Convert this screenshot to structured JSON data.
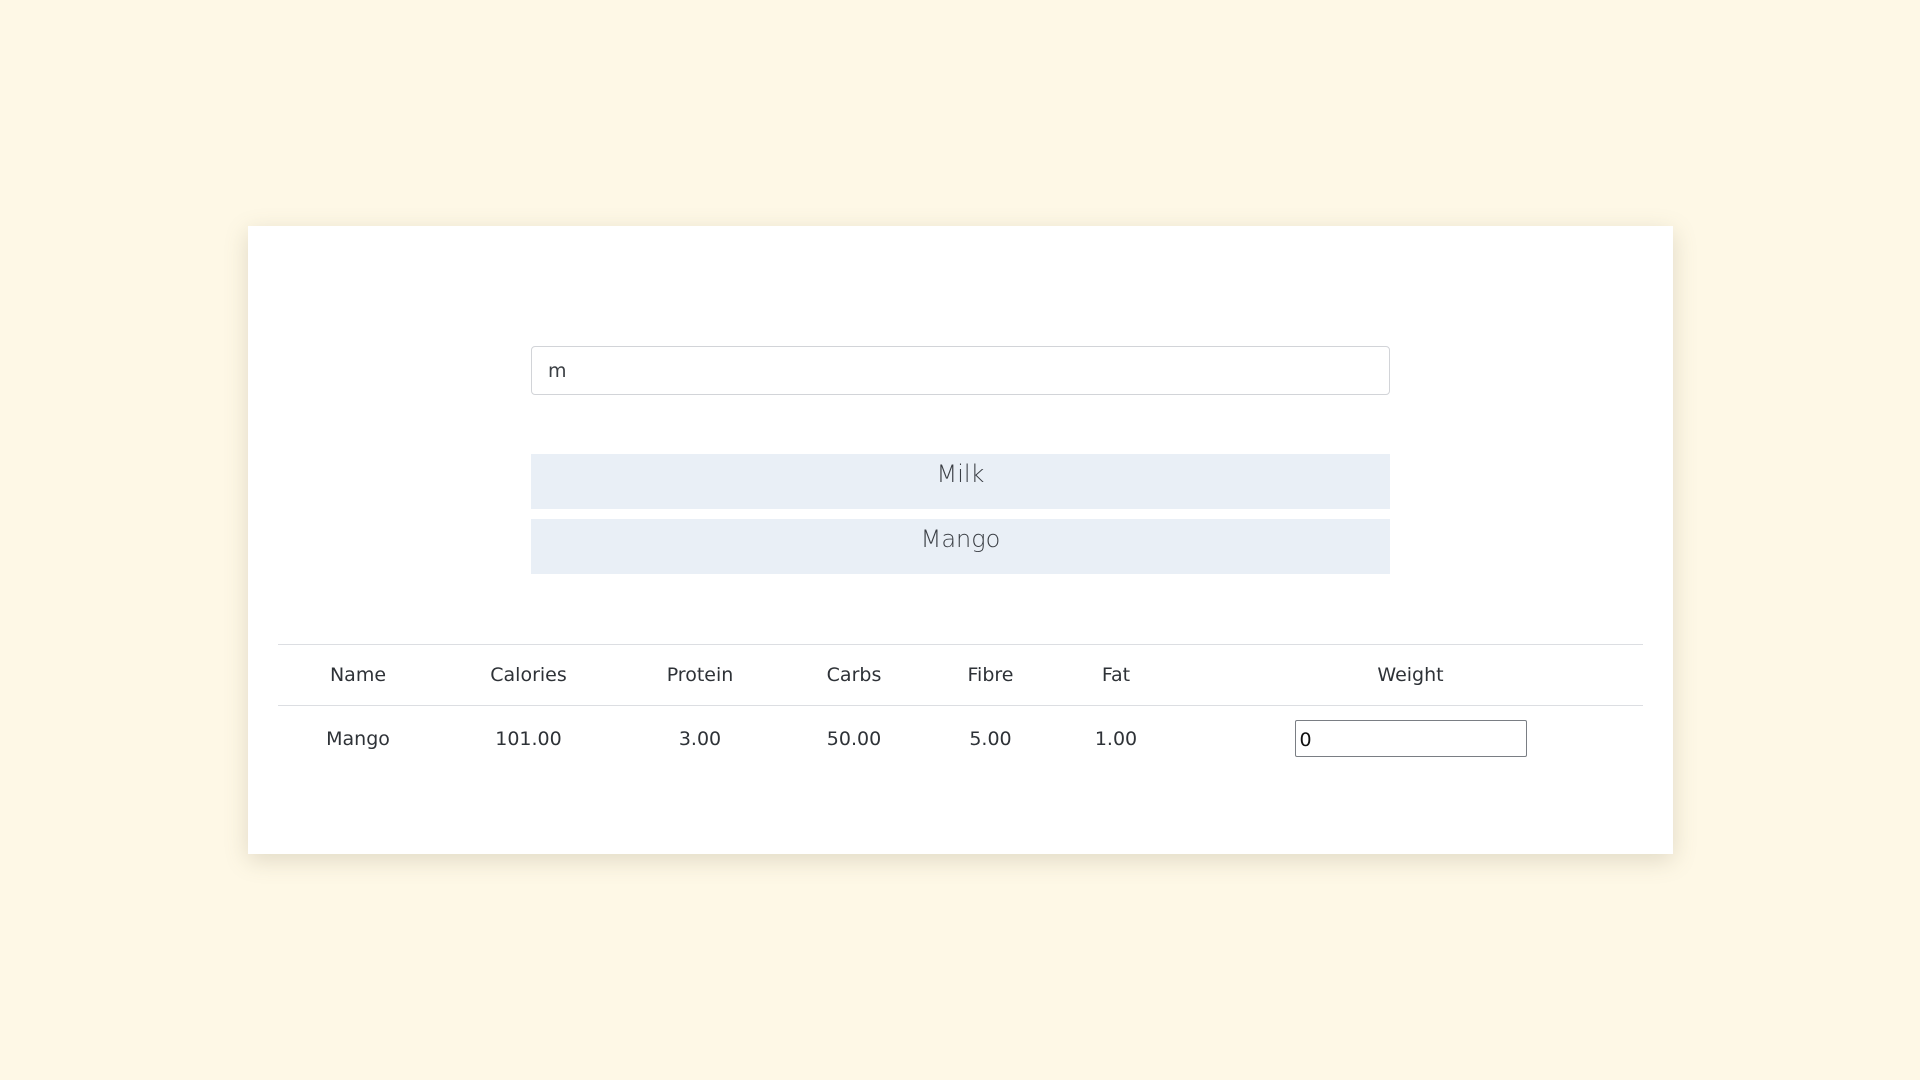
{
  "search": {
    "value": "m",
    "placeholder": ""
  },
  "suggestions": [
    "Milk",
    "Mango"
  ],
  "table": {
    "headers": [
      "Name",
      "Calories",
      "Protein",
      "Carbs",
      "Fibre",
      "Fat",
      "Weight"
    ],
    "rows": [
      {
        "name": "Mango",
        "calories": "101.00",
        "protein": "3.00",
        "carbs": "50.00",
        "fibre": "5.00",
        "fat": "1.00",
        "weight": "0"
      }
    ]
  },
  "colors": {
    "page_background": "#fef8e6",
    "card_background": "#ffffff",
    "suggestion_background": "#e9eff6"
  }
}
